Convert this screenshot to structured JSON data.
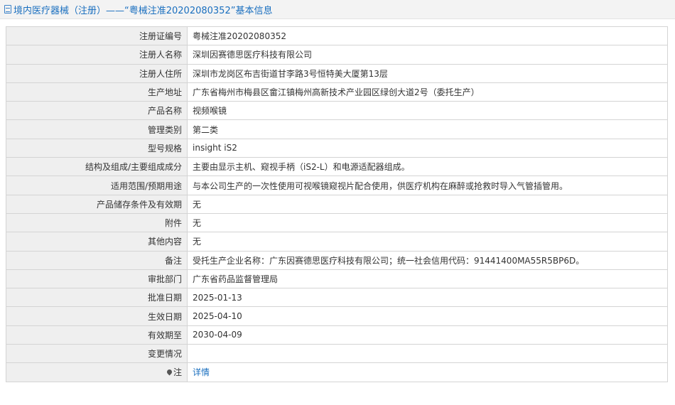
{
  "header": {
    "icon": "document-icon",
    "title": "境内医疗器械（注册）——“粤械注准20202080352”基本信息"
  },
  "rows": [
    {
      "label": "注册证编号",
      "value": "粤械注准20202080352"
    },
    {
      "label": "注册人名称",
      "value": "深圳因赛德思医疗科技有限公司"
    },
    {
      "label": "注册人住所",
      "value": "深圳市龙岗区布吉街道甘李路3号恒特美大厦第13层"
    },
    {
      "label": "生产地址",
      "value": "广东省梅州市梅县区畲江镇梅州高新技术产业园区绿创大道2号（委托生产）"
    },
    {
      "label": "产品名称",
      "value": "视频喉镜"
    },
    {
      "label": "管理类别",
      "value": "第二类"
    },
    {
      "label": "型号规格",
      "value": "insight iS2"
    },
    {
      "label": "结构及组成/主要组成成分",
      "value": "主要由显示主机、窥视手柄（iS2-L）和电源适配器组成。"
    },
    {
      "label": "适用范围/预期用途",
      "value": "与本公司生产的一次性使用可视喉镜窥视片配合使用，供医疗机构在麻醉或抢救时导入气管插管用。"
    },
    {
      "label": "产品储存条件及有效期",
      "value": "无"
    },
    {
      "label": "附件",
      "value": "无"
    },
    {
      "label": "其他内容",
      "value": "无"
    },
    {
      "label": "备注",
      "value": "受托生产企业名称：广东因赛德思医疗科技有限公司；统一社会信用代码：91441400MA55R5BP6D。"
    },
    {
      "label": "审批部门",
      "value": "广东省药品监督管理局"
    },
    {
      "label": "批准日期",
      "value": "2025-01-13"
    },
    {
      "label": "生效日期",
      "value": "2025-04-10"
    },
    {
      "label": "有效期至",
      "value": "2030-04-09"
    },
    {
      "label": "变更情况",
      "value": ""
    }
  ],
  "note_row": {
    "icon": "pin-icon",
    "label": "注",
    "link_text": "详情"
  }
}
